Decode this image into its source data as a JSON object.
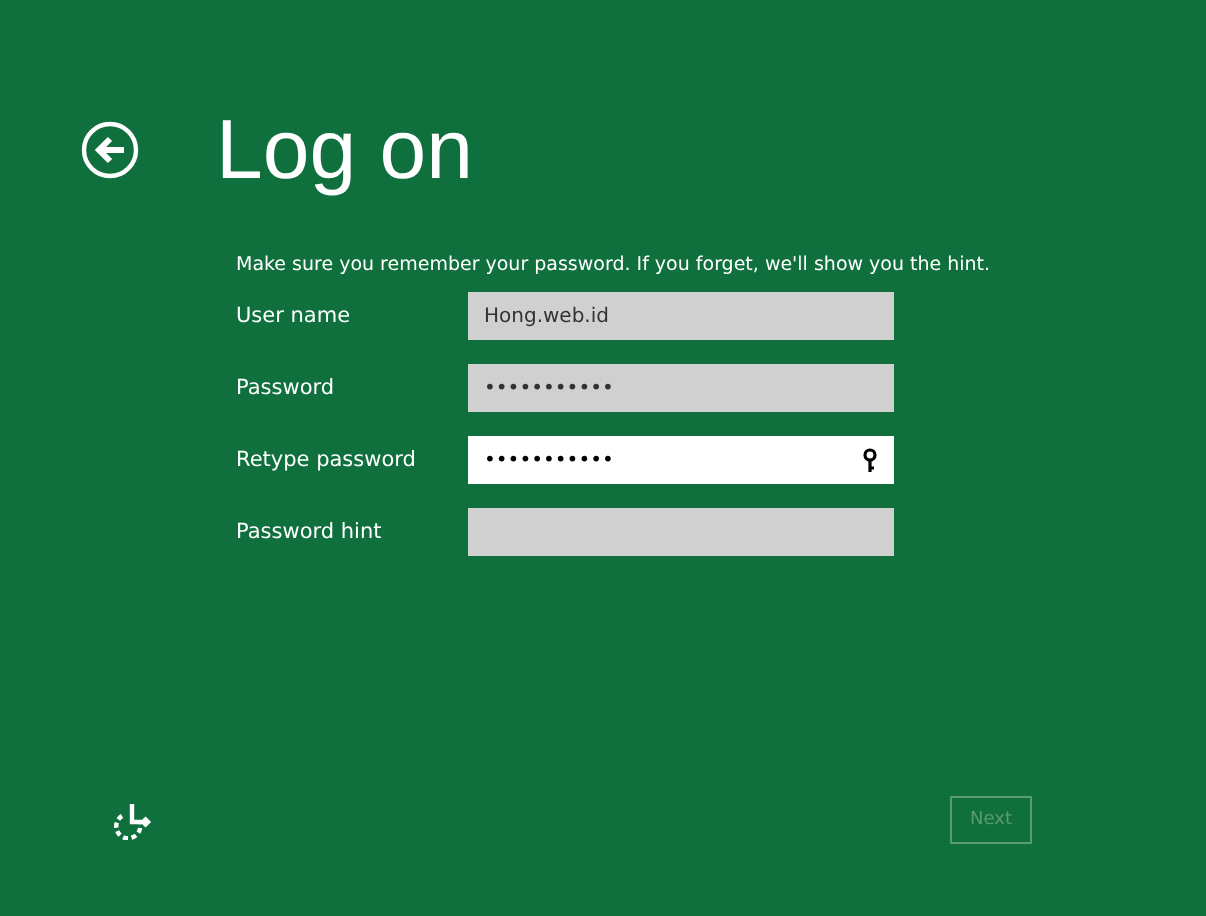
{
  "title": "Log on",
  "instruction": "Make sure you remember your password. If you forget, we'll show you the hint.",
  "fields": [
    {
      "label": "User name",
      "value": "Hong.web.id",
      "focused": false
    },
    {
      "label": "Password",
      "value": "•••••••••••",
      "focused": false
    },
    {
      "label": "Retype password",
      "value": "•••••••••••",
      "focused": true
    },
    {
      "label": "Password hint",
      "focused": false
    }
  ],
  "next_button": {
    "label": "Next",
    "disabled": true
  }
}
